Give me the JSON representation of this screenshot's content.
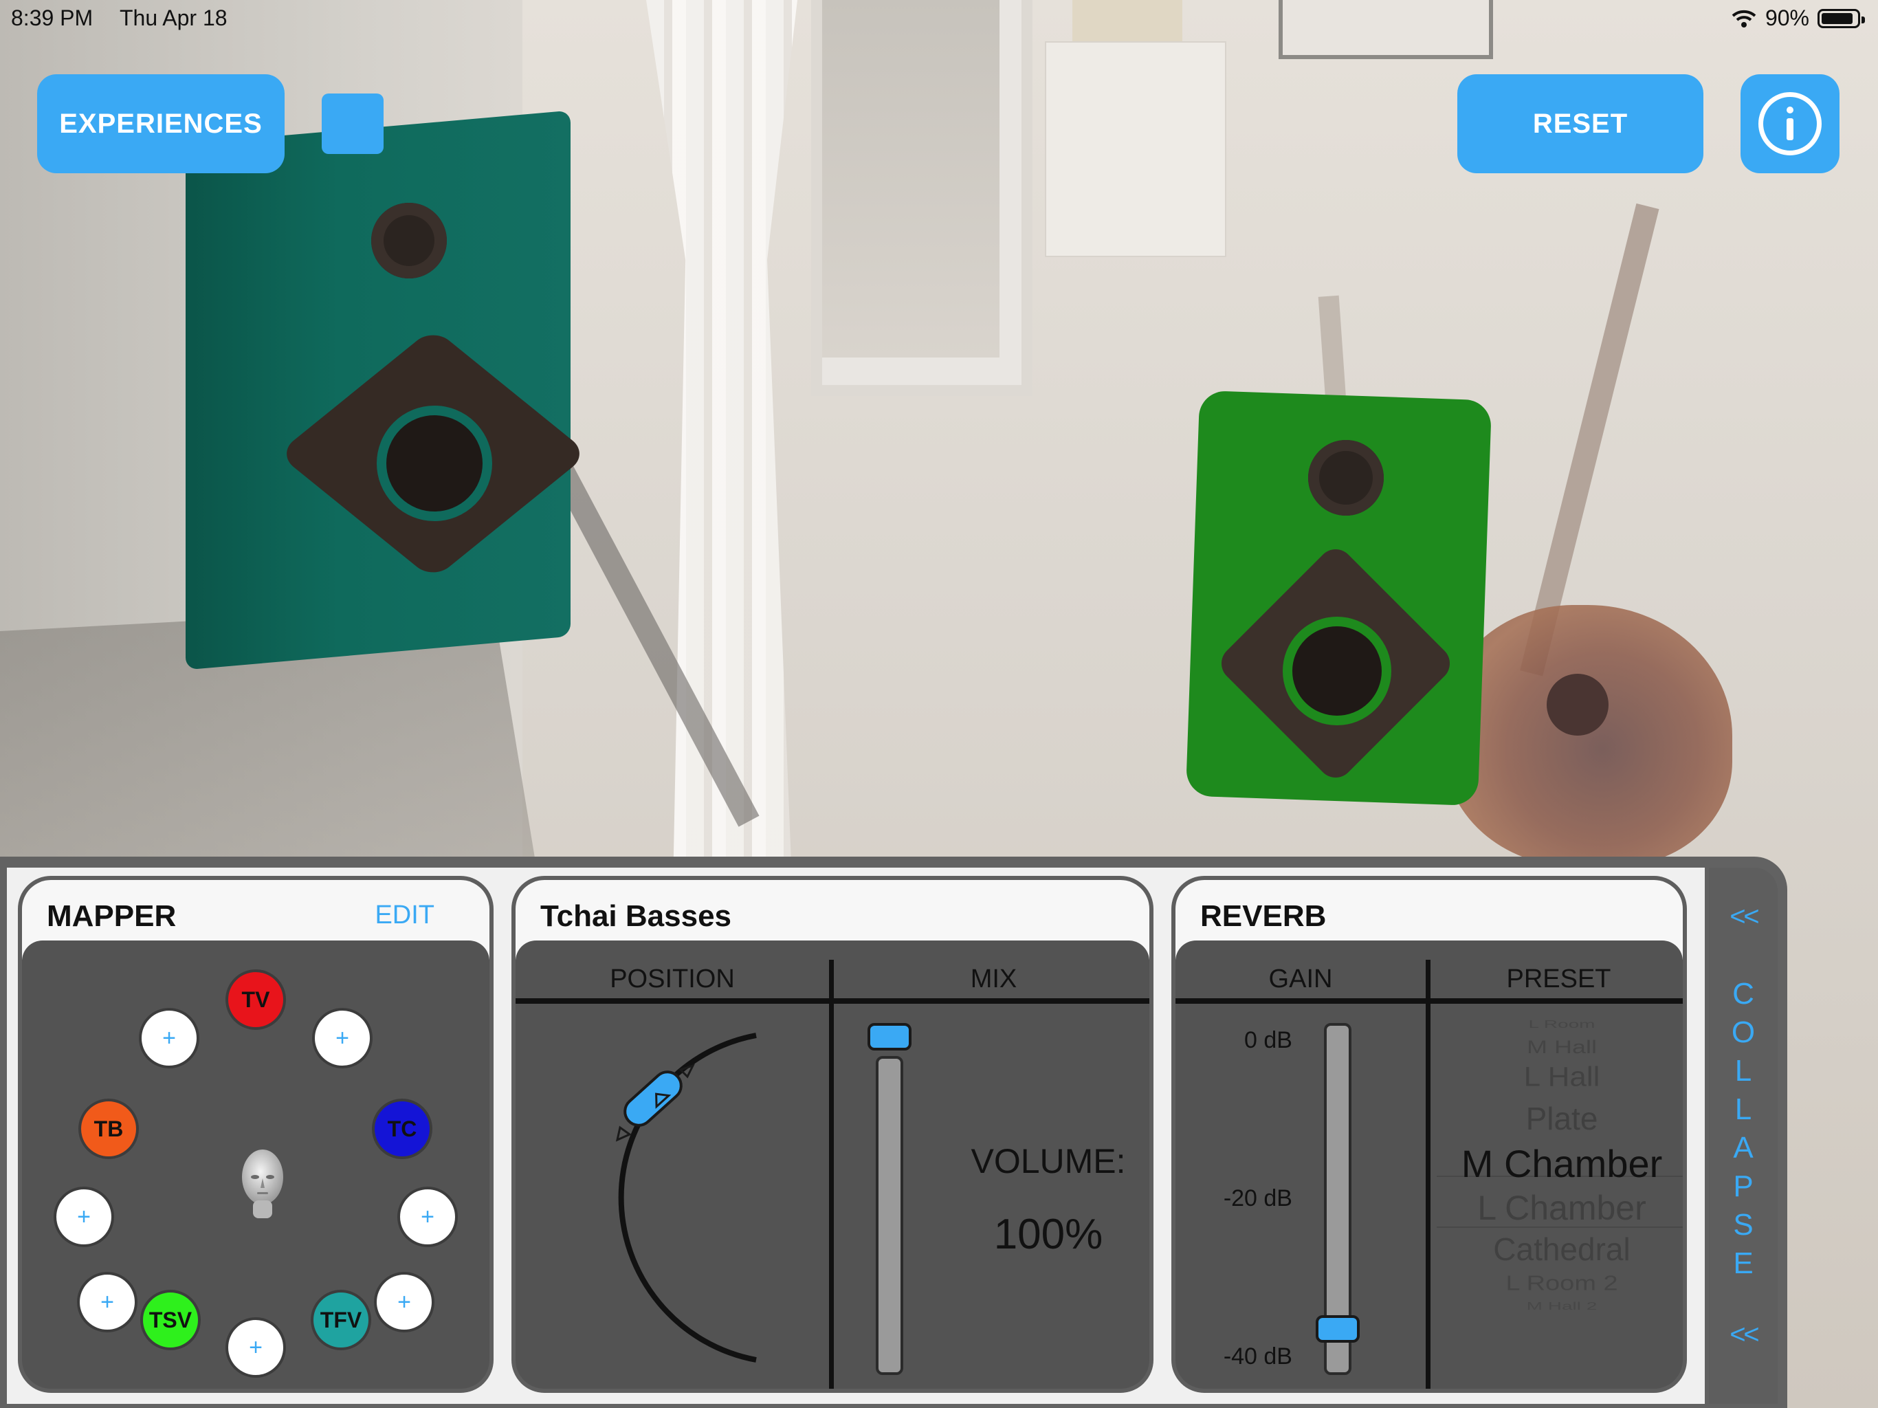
{
  "status_bar": {
    "time": "8:39 PM",
    "date": "Thu Apr 18",
    "battery": "90%",
    "battery_level": 0.9
  },
  "toolbar": {
    "experiences_label": "EXPERIENCES",
    "reset_label": "RESET",
    "info_icon": "info-icon"
  },
  "colors": {
    "accent": "#3aa9f4",
    "panel": "#535353",
    "speaker_teal": "#0f6a5c",
    "speaker_green": "#1e8a1d"
  },
  "mapper": {
    "title": "MAPPER",
    "edit_label": "EDIT",
    "add_symbol": "+",
    "assigned_nodes": [
      {
        "label": "TV",
        "color": "#e8141b"
      },
      {
        "label": "TC",
        "color": "#1414d6"
      },
      {
        "label": "TFV",
        "color": "#1fa3a0"
      },
      {
        "label": "TSV",
        "color": "#2ef01c"
      },
      {
        "label": "TB",
        "color": "#f15a1a"
      }
    ]
  },
  "source": {
    "title": "Tchai Basses",
    "position_header": "POSITION",
    "mix_header": "MIX",
    "volume_label": "VOLUME:",
    "volume_value": "100%",
    "mix_level": 1.0
  },
  "reverb": {
    "title": "REVERB",
    "gain_header": "GAIN",
    "preset_header": "PRESET",
    "gain_ticks": [
      "0 dB",
      "-20 dB",
      "-40 dB"
    ],
    "gain_value_db": -36,
    "presets": [
      "L Room",
      "M Hall",
      "L Hall",
      "Plate",
      "M Chamber",
      "L Chamber",
      "Cathedral",
      "L Room 2",
      "M Hall 2"
    ],
    "selected_preset": "M Chamber"
  },
  "collapse": {
    "arrow_top": "<<",
    "letters": [
      "C",
      "O",
      "L",
      "L",
      "A",
      "P",
      "S",
      "E"
    ],
    "arrow_bottom": "<<"
  }
}
